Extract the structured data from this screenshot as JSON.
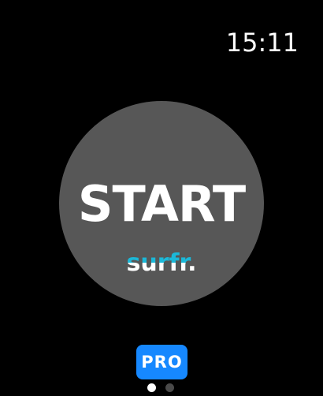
{
  "status_bar": {
    "time": "15:11"
  },
  "main": {
    "start_label": "START",
    "logo_text": "surfr.",
    "logo_colors": {
      "top": "#1bb8d8",
      "bottom": "#ffffff"
    },
    "circle_color": "#575757"
  },
  "pro_button": {
    "label": "PRO",
    "color": "#1688ff"
  },
  "page_indicator": {
    "total": 2,
    "current": 1
  }
}
